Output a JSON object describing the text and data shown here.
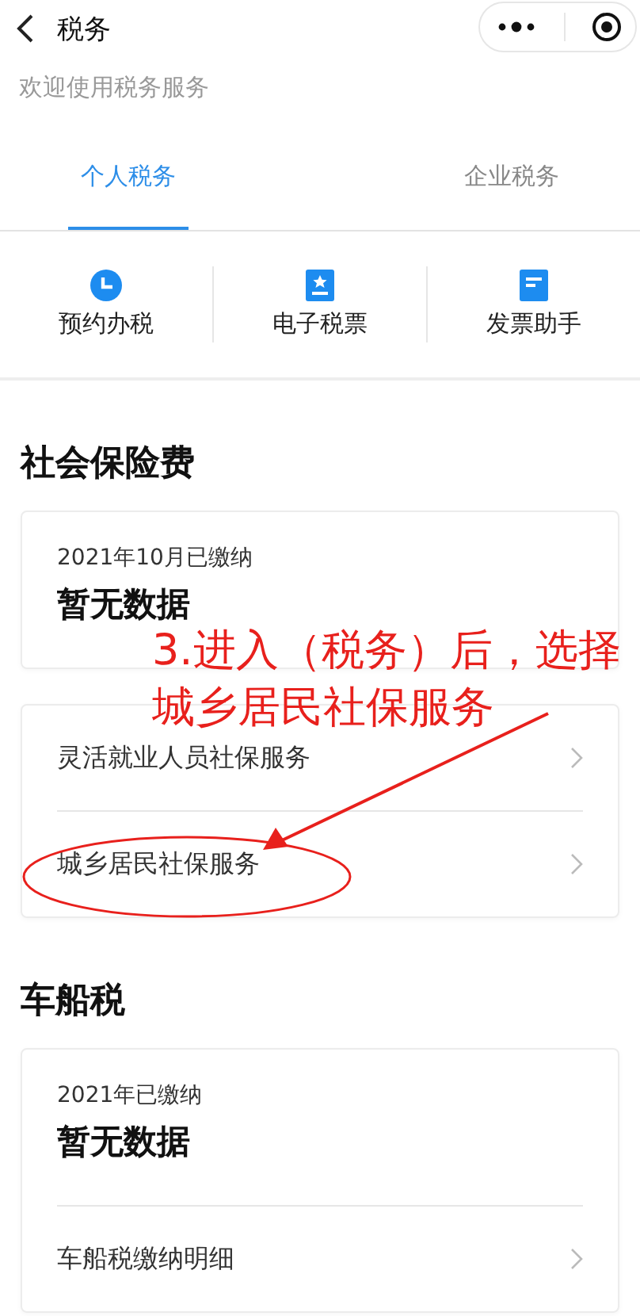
{
  "header": {
    "title": "税务"
  },
  "welcome": "欢迎使用税务服务",
  "tabs": [
    {
      "label": "个人税务",
      "selected": true
    },
    {
      "label": "企业税务",
      "selected": false
    }
  ],
  "shortcuts": [
    {
      "label": "预约办税",
      "kind": "clock"
    },
    {
      "label": "电子税票",
      "kind": "ticket"
    },
    {
      "label": "发票助手",
      "kind": "document"
    }
  ],
  "sections": [
    {
      "title": "社会保险费",
      "cards": [
        {
          "caption": "2021年10月已缴纳",
          "value": "暂无数据"
        },
        {
          "links": [
            "灵活就业人员社保服务",
            "城乡居民社保服务"
          ]
        }
      ]
    },
    {
      "title": "车船税",
      "cards": [
        {
          "caption": "2021年已缴纳",
          "value": "暂无数据",
          "links": [
            "车船税缴纳明细"
          ]
        }
      ]
    }
  ],
  "annotation": {
    "lines": [
      "3.进入（税务）后，选择",
      "城乡居民社保服务"
    ]
  }
}
